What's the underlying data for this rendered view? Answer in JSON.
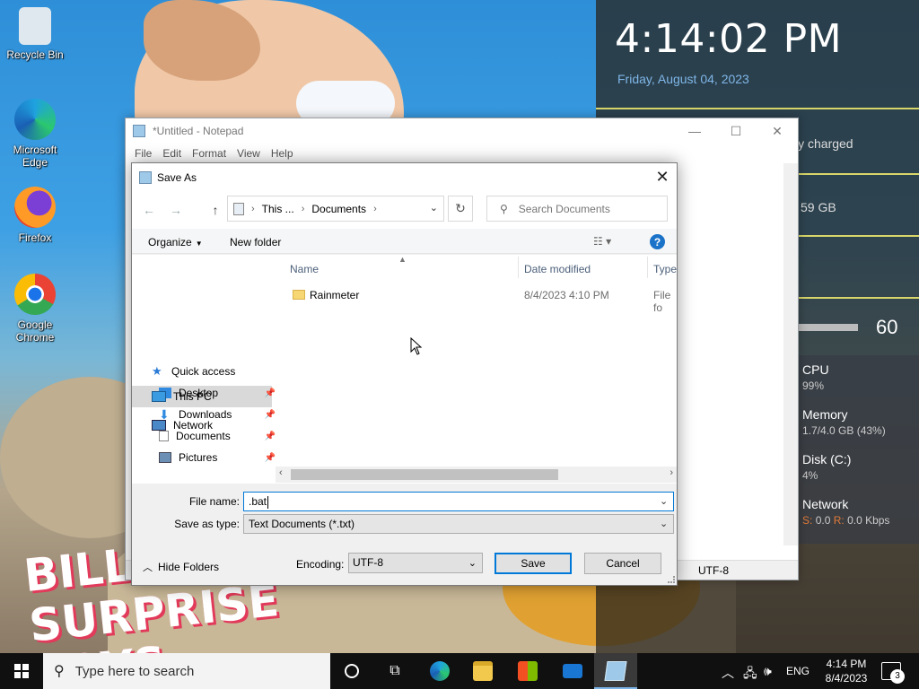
{
  "desktop": {
    "icons": [
      {
        "label": "Recycle Bin"
      },
      {
        "label": "Microsoft Edge"
      },
      {
        "label": "Firefox"
      },
      {
        "label": "Google Chrome"
      }
    ],
    "wallpaper_text": "BILLION SURPRISE TOYS"
  },
  "rainmeter": {
    "time": "4:14:02 PM",
    "date": "Friday, August 04, 2023",
    "battery": "ly charged",
    "disk_free": "59 GB",
    "volume": "60",
    "cpu": {
      "label": "CPU",
      "value": "99%"
    },
    "memory": {
      "label": "Memory",
      "value": "1.7/4.0 GB (43%)"
    },
    "disk": {
      "label": "Disk (C:)",
      "value": "4%"
    },
    "network": {
      "label": "Network",
      "s_label": "S:",
      "s_value": "0.0",
      "r_label": "R:",
      "r_value": "0.0 Kbps"
    }
  },
  "notepad": {
    "title": "*Untitled - Notepad",
    "menu": [
      "File",
      "Edit",
      "Format",
      "View",
      "Help"
    ],
    "status_encoding": "UTF-8"
  },
  "save_as": {
    "title": "Save As",
    "address": {
      "crumbs": [
        "This ...",
        "Documents"
      ]
    },
    "search_placeholder": "Search Documents",
    "toolbar": {
      "organize": "Organize",
      "new_folder": "New folder"
    },
    "tree": [
      {
        "label": "Quick access"
      },
      {
        "label": "Desktop"
      },
      {
        "label": "Downloads"
      },
      {
        "label": "Documents"
      },
      {
        "label": "Pictures"
      },
      {
        "label": "This PC"
      },
      {
        "label": "Network"
      }
    ],
    "columns": [
      "Name",
      "Date modified",
      "Type"
    ],
    "files": [
      {
        "name": "Rainmeter",
        "date": "8/4/2023 4:10 PM",
        "type": "File fo"
      }
    ],
    "file_name_label": "File name:",
    "file_name_value": ".bat",
    "save_type_label": "Save as type:",
    "save_type_value": "Text Documents (*.txt)",
    "hide_folders": "Hide Folders",
    "encoding_label": "Encoding:",
    "encoding_value": "UTF-8",
    "save_button": "Save",
    "cancel_button": "Cancel"
  },
  "taskbar": {
    "search_placeholder": "Type here to search",
    "lang": "ENG",
    "time": "4:14 PM",
    "date": "8/4/2023",
    "notifications": "3"
  }
}
